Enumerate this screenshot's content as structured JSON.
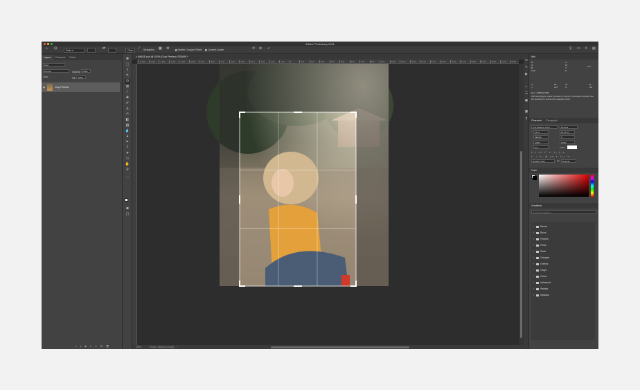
{
  "app": {
    "title": "Adobe Photoshop 2021",
    "traffic_lights": [
      "#ff5f57",
      "#febc2e",
      "#28c840"
    ]
  },
  "options_bar": {
    "ratio_select": "Ratio",
    "clear_label": "Clear",
    "straighten_label": "Straighten",
    "delete_cropped_label": "Delete Cropped Pixels",
    "content_aware_label": "Content-Aware"
  },
  "layers_panel": {
    "tabs": [
      "Layers",
      "Channels",
      "Paths"
    ],
    "kind_filter": "Kind",
    "blend_mode": "Normal",
    "opacity_label": "Opacity:",
    "opacity_value": "100%",
    "lock_label": "Lock:",
    "fill_label": "Fill:",
    "fill_value": "100%",
    "layers": [
      {
        "name": "Crop Preview"
      }
    ]
  },
  "document": {
    "tab_title": "IMAGE.psd @ 100% (Crop Preview, RGB/8*) *",
    "zoom": "100%",
    "doc_info": "776 px x 1163 px (72 ppi)",
    "ruler_ticks": [
      "-1500",
      "-1400",
      "-1300",
      "-1200",
      "-1100",
      "-1000",
      "-900",
      "-800",
      "-700",
      "-600",
      "-500",
      "-400",
      "-300",
      "-200",
      "-100",
      "0",
      "100",
      "200",
      "300",
      "400",
      "500",
      "600",
      "700",
      "800",
      "900",
      "1000",
      "1100",
      "1200",
      "1300",
      "1400",
      "1500",
      "1600",
      "1700",
      "1800",
      "1900",
      "2000",
      "2100",
      "2200"
    ]
  },
  "info_panel": {
    "title": "Info",
    "r_label": "R:",
    "g_label": "G:",
    "b_label": "B:",
    "bit_depth": "8-bit",
    "c_label": "C:",
    "m_label": "M:",
    "y_label": "Y:",
    "k_label": "K:",
    "x_label": "X:",
    "y_coord_label": "Y:",
    "x_value": "80",
    "y_value": "287",
    "w_label": "W:",
    "h_label": "H:",
    "w_value": "51",
    "h_value": "760",
    "angle_value": "0.0°",
    "doc_size": "Doc: 2.58M/2.58M",
    "help_text": "Click and drag to resize. Hit enter to commit, hit escape to cancel. Use the spacebar to access the navigation tools."
  },
  "character_panel": {
    "tabs": [
      "Character",
      "Paragraph"
    ],
    "font_family": "Arts Madrelo Grap...",
    "font_style": "Regular",
    "font_size": "12 pt",
    "leading": "16.71 pt",
    "kerning": "Metrics",
    "tracking": "0",
    "vertical_scale": "100%",
    "horizontal_scale": "100%",
    "baseline_shift": "0 pt",
    "color_label": "Color:",
    "language": "English: USA",
    "antialias": "Smooth",
    "aa_prefix": "aa"
  },
  "color_panel": {
    "title": "Color",
    "hue_color": "#e00000"
  },
  "gradients_panel": {
    "title": "Gradients",
    "search_placeholder": "Search Gradients",
    "folders": [
      "Basics",
      "Blues",
      "Purples",
      "Pinks",
      "Reds",
      "Oranges",
      "Greens",
      "Grays",
      "Cloud",
      "Iridescent",
      "Pastels",
      "Neutrals"
    ]
  }
}
